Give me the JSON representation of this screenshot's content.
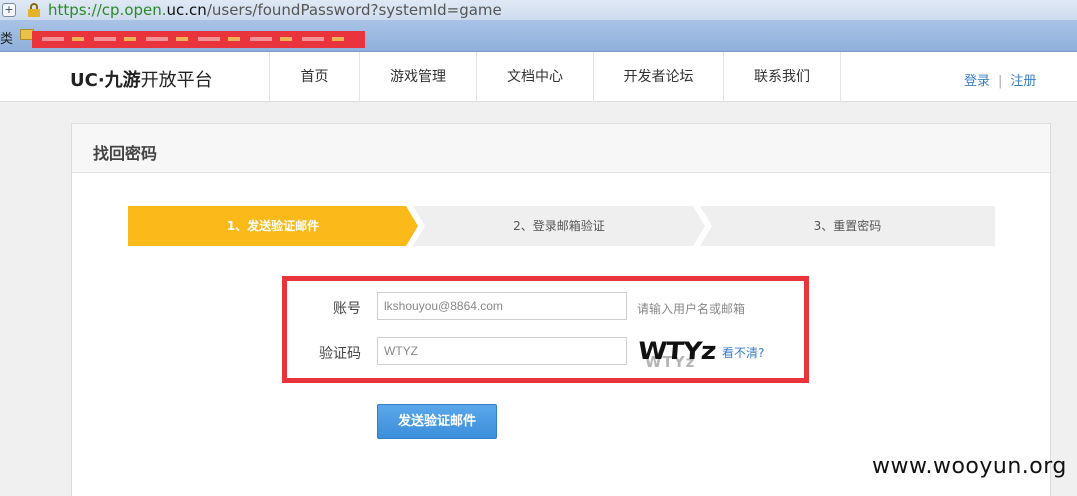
{
  "browser": {
    "url_scheme": "https://",
    "url_host_pre": "cp.open.",
    "url_host_em": "uc.cn",
    "url_path": "/users/foundPassword?systemId=game",
    "bookmarks_label": "类"
  },
  "header": {
    "logo_brand": "UC·九游",
    "logo_suffix": "开放平台",
    "nav": [
      "首页",
      "游戏管理",
      "文档中心",
      "开发者论坛",
      "联系我们"
    ],
    "login_label": "登录",
    "separator": "|",
    "register_label": "注册"
  },
  "panel": {
    "title": "找回密码",
    "steps": [
      "1、发送验证邮件",
      "2、登录邮箱验证",
      "3、重置密码"
    ],
    "active_step": 1
  },
  "form": {
    "account_label": "账号",
    "account_value": "lkshouyou@8864.com",
    "account_hint": "请输入用户名或邮箱",
    "captcha_label": "验证码",
    "captcha_value": "WTYZ",
    "captcha_image_text": "WTYz",
    "captcha_refresh": "看不清?",
    "submit_label": "发送验证邮件"
  },
  "watermark": "www.wooyun.org",
  "colors": {
    "active_step": "#fbb91a",
    "highlight_border": "#e8343a",
    "button": "#3d8fdb",
    "link": "#3a7fc4"
  }
}
